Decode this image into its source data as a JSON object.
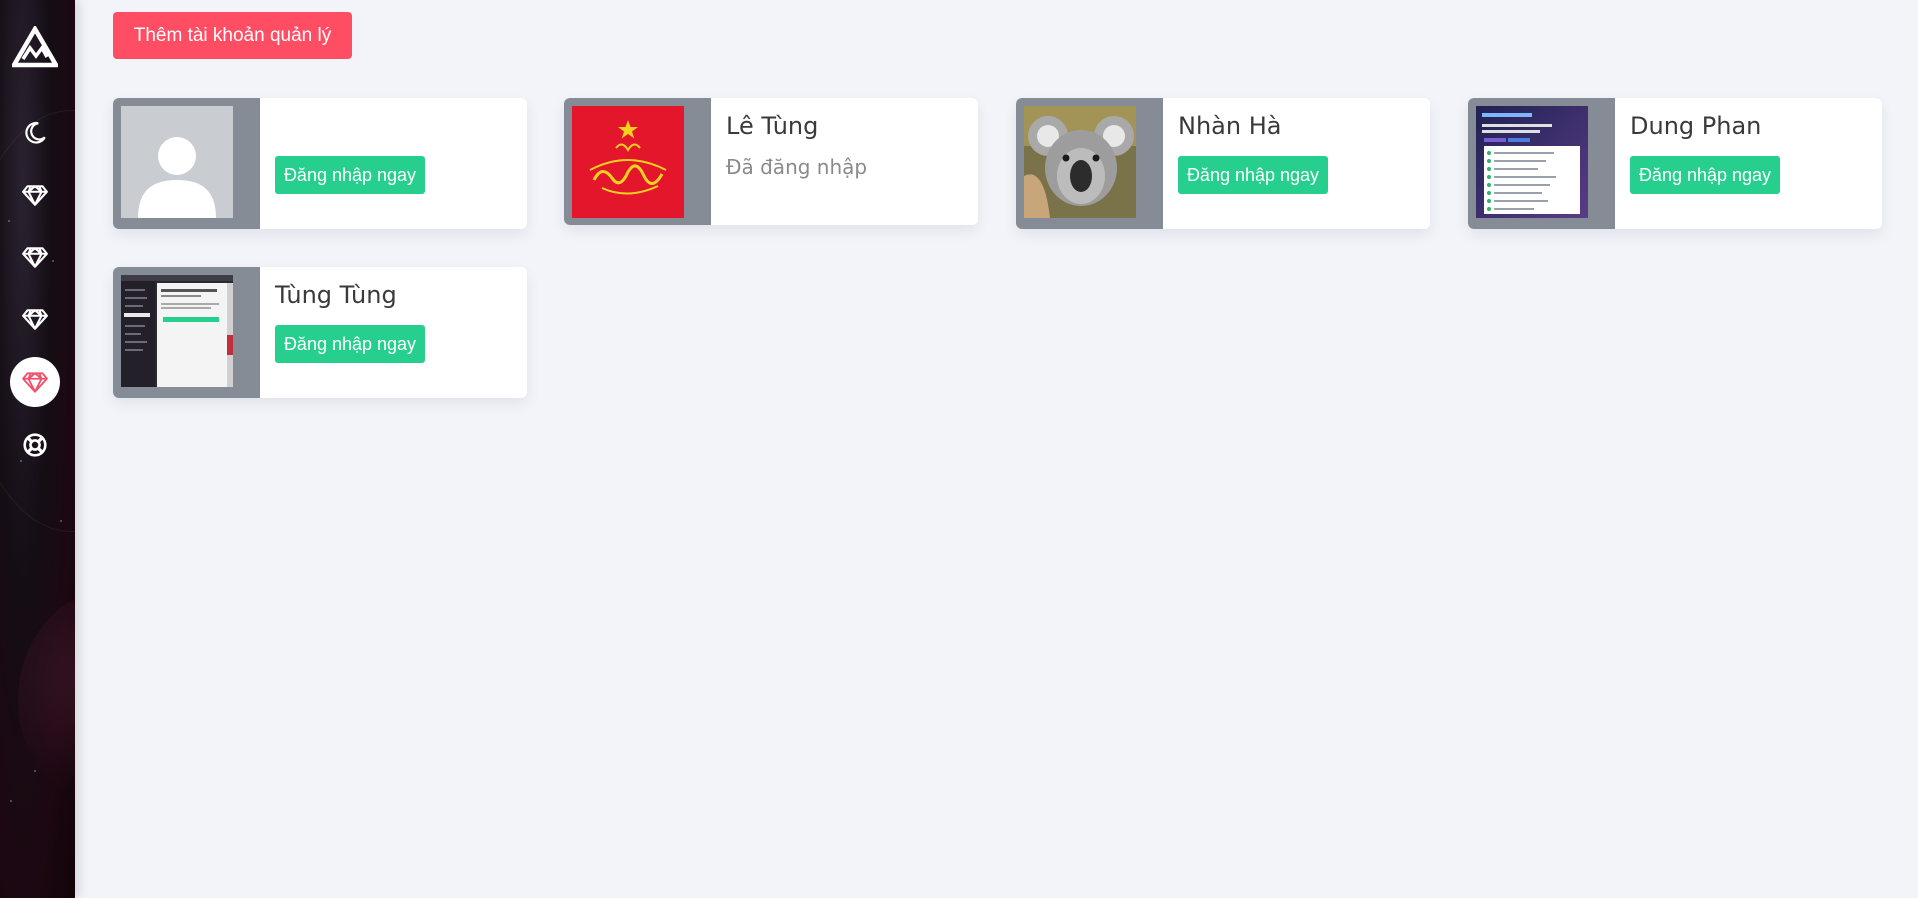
{
  "sidebar": {
    "logo": "mountain-logo",
    "items": [
      {
        "icon": "moon-icon",
        "active": false
      },
      {
        "icon": "diamond-icon",
        "active": false
      },
      {
        "icon": "diamond-icon",
        "active": false
      },
      {
        "icon": "diamond-icon",
        "active": false
      },
      {
        "icon": "diamond-icon",
        "active": true
      },
      {
        "icon": "lifebuoy-icon",
        "active": false
      }
    ]
  },
  "toolbar": {
    "add_label": "Thêm tài khoản quản lý"
  },
  "accounts": [
    {
      "name": "",
      "status": "",
      "button": "Đăng nhập ngay",
      "avatar": "default-user-avatar"
    },
    {
      "name": "Lê Tùng",
      "status": "Đã đăng nhập",
      "button": "",
      "avatar": "vietnam-logo-avatar"
    },
    {
      "name": "Nhàn Hà",
      "status": "",
      "button": "Đăng nhập ngay",
      "avatar": "koala-avatar"
    },
    {
      "name": "Dung Phan",
      "status": "",
      "button": "Đăng nhập ngay",
      "avatar": "app-screenshot-avatar"
    },
    {
      "name": "Tùng Tùng",
      "status": "",
      "button": "Đăng nhập ngay",
      "avatar": "desktop-screenshot-avatar"
    }
  ],
  "colors": {
    "accent_red": "#ff4e64",
    "accent_green": "#26cf8e",
    "active_icon": "#f0506a",
    "background": "#f2f4f9"
  }
}
